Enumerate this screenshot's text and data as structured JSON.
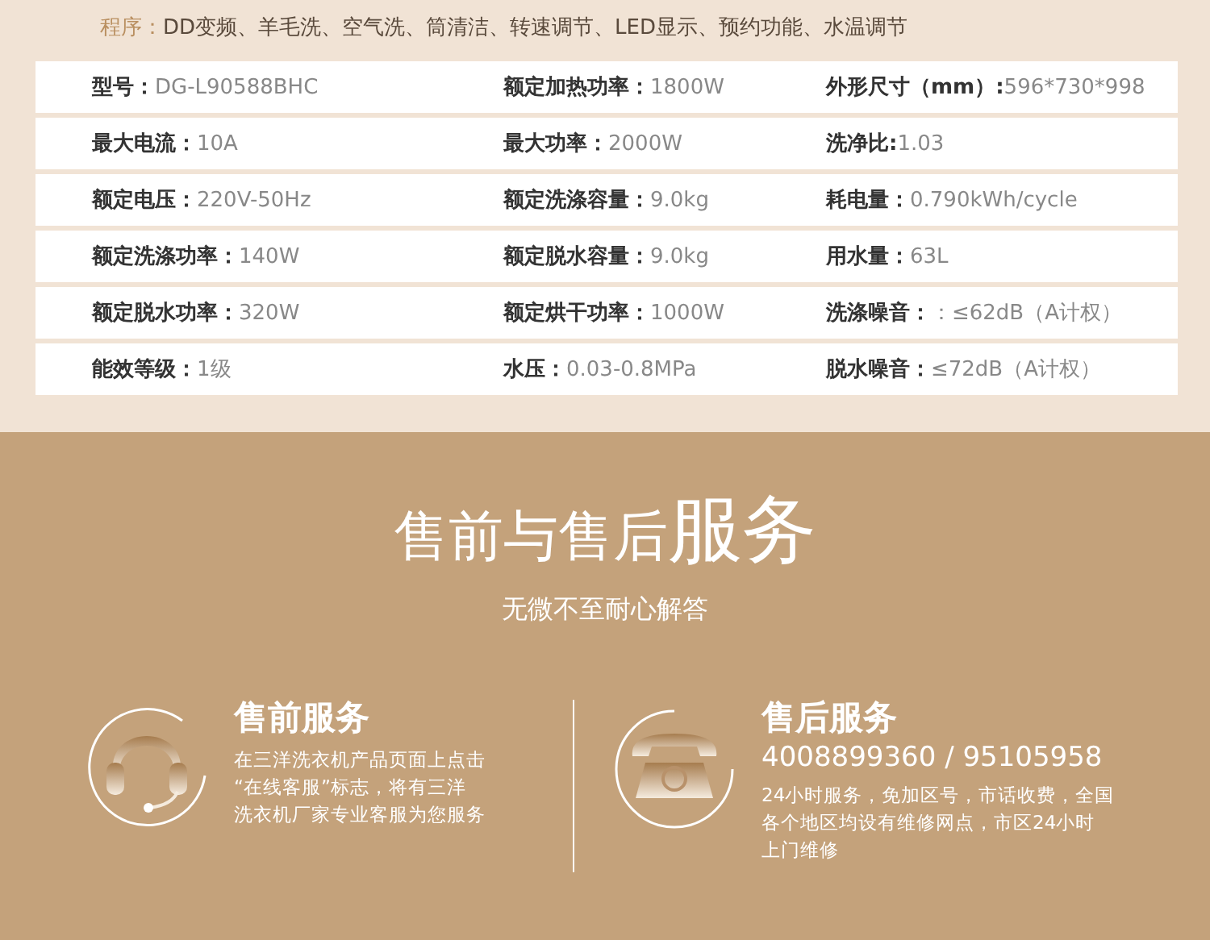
{
  "program": {
    "label": "程序：",
    "value": "DD变频、羊毛洗、空气洗、筒清洁、转速调节、LED显示、预约功能、水温调节"
  },
  "specs": [
    [
      {
        "label": "型号：",
        "value": "DG-L90588BHC"
      },
      {
        "label": "额定加热功率：",
        "value": "1800W"
      },
      {
        "label": "外形尺寸（mm）:",
        "value": "596*730*998"
      }
    ],
    [
      {
        "label": "最大电流：",
        "value": "10A"
      },
      {
        "label": "最大功率：",
        "value": "2000W"
      },
      {
        "label": "洗净比:",
        "value": "1.03"
      }
    ],
    [
      {
        "label": "额定电压：",
        "value": "220V-50Hz"
      },
      {
        "label": "额定洗涤容量：",
        "value": "9.0kg"
      },
      {
        "label": "耗电量：",
        "value": "0.790kWh/cycle"
      }
    ],
    [
      {
        "label": "额定洗涤功率：",
        "value": "140W"
      },
      {
        "label": "额定脱水容量：",
        "value": "9.0kg"
      },
      {
        "label": "用水量：",
        "value": "63L"
      }
    ],
    [
      {
        "label": "额定脱水功率：",
        "value": "320W"
      },
      {
        "label": "额定烘干功率：",
        "value": "1000W"
      },
      {
        "label": "洗涤噪音：",
        "value": "：≤62dB（A计权）"
      }
    ],
    [
      {
        "label": "能效等级：",
        "value": "1级"
      },
      {
        "label": "水压：",
        "value": "0.03-0.8MPa"
      },
      {
        "label": "脱水噪音：",
        "value": "≤72dB（A计权）"
      }
    ]
  ],
  "service": {
    "title": "售前与售后",
    "title_emphasis": "服务",
    "subtitle": "无微不至耐心解答",
    "items": [
      {
        "kind": "headset",
        "title": "售前服务",
        "lines": [
          "在三洋洗衣机产品页面上点击",
          "“在线客服”标志，将有三洋",
          "洗衣机厂家专业客服为您服务"
        ]
      },
      {
        "kind": "phone",
        "title": "售后服务",
        "phone": "4008899360 / 95105958",
        "lines": [
          "24小时服务，免加区号，市话收费，全国",
          "各个地区均设有维修网点，市区24小时",
          "上门维修"
        ]
      }
    ]
  }
}
